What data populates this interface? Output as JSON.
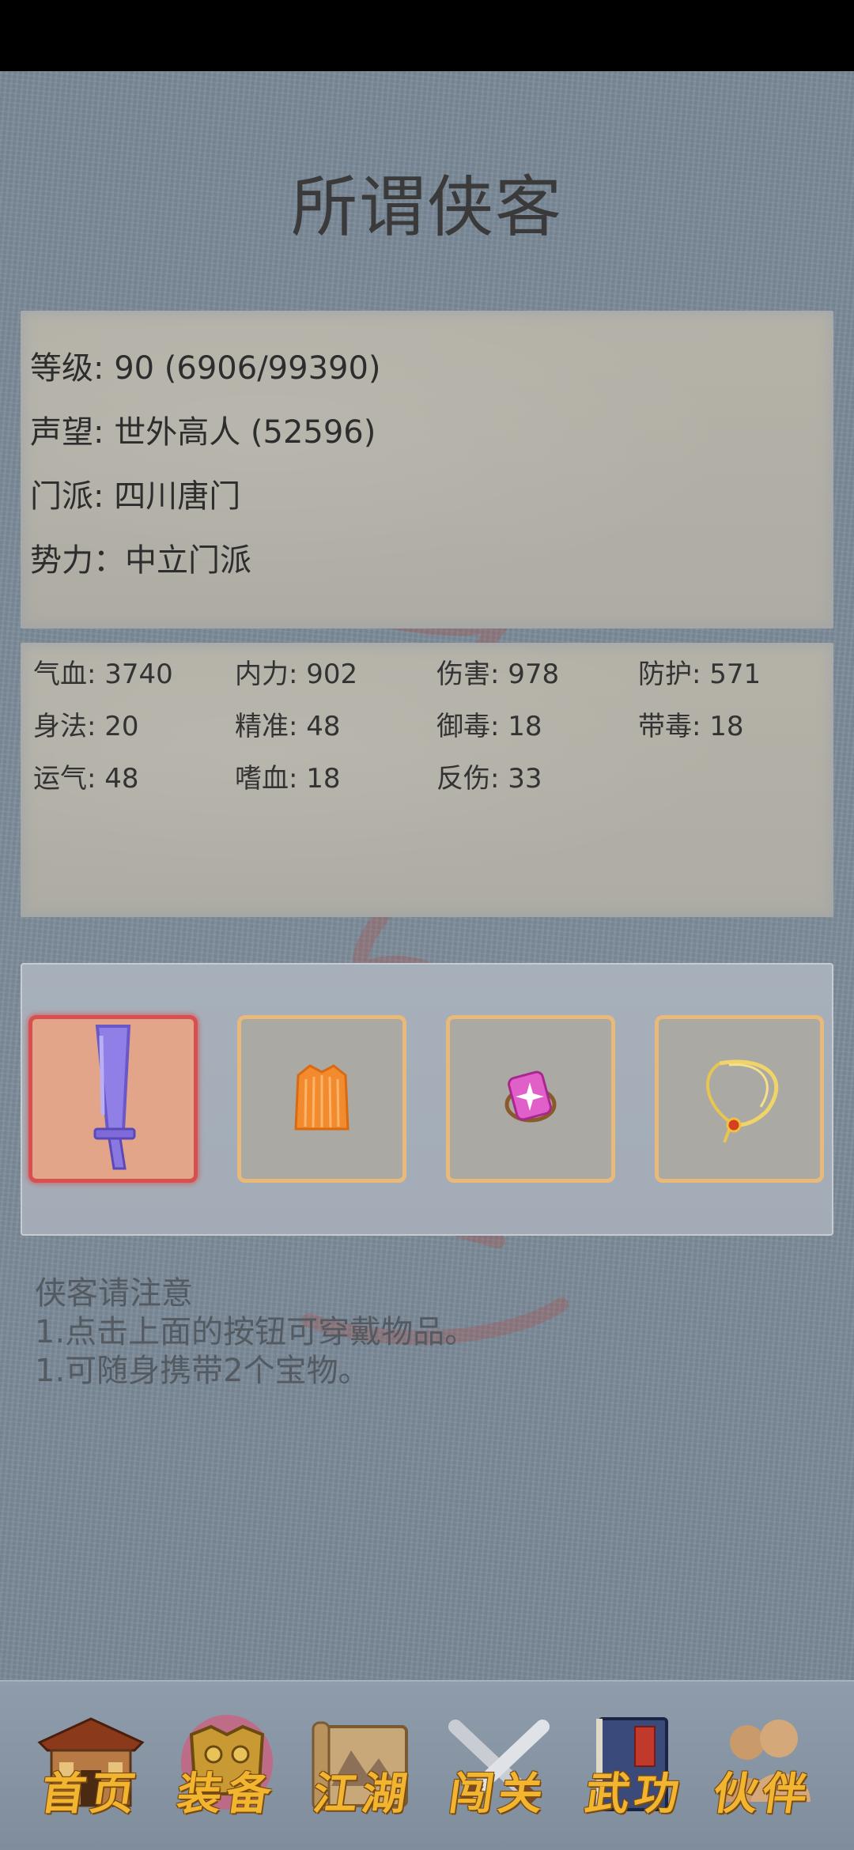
{
  "app": {
    "title": "所谓侠客"
  },
  "info": {
    "level": "等级: 90 (6906/99390)",
    "reputation": "声望: 世外高人 (52596)",
    "sect": "门派: 四川唐门",
    "faction": "势力：中立门派"
  },
  "stats": [
    {
      "label": "气血: 3740"
    },
    {
      "label": "内力: 902"
    },
    {
      "label": "伤害: 978"
    },
    {
      "label": "防护: 571"
    },
    {
      "label": "身法: 20"
    },
    {
      "label": "精准: 48"
    },
    {
      "label": "御毒: 18"
    },
    {
      "label": "带毒: 18"
    },
    {
      "label": "运气: 48"
    },
    {
      "label": "嗜血: 18"
    },
    {
      "label": "反伤: 33"
    }
  ],
  "equipment": {
    "slots": [
      {
        "icon": "sword-icon",
        "selected": true
      },
      {
        "icon": "robe-icon",
        "selected": false
      },
      {
        "icon": "gem-ring-icon",
        "selected": false
      },
      {
        "icon": "necklace-icon",
        "selected": false
      }
    ]
  },
  "notice": {
    "heading": "侠客请注意",
    "line1": "1.点击上面的按钮可穿戴物品。",
    "line2": "1.可随身携带2个宝物。"
  },
  "nav": {
    "items": [
      {
        "label": "首页",
        "icon": "house-icon"
      },
      {
        "label": "装备",
        "icon": "armor-icon"
      },
      {
        "label": "江湖",
        "icon": "scroll-map-icon"
      },
      {
        "label": "闯关",
        "icon": "crossed-swords-icon"
      },
      {
        "label": "武功",
        "icon": "book-icon"
      },
      {
        "label": "伙伴",
        "icon": "companions-icon"
      }
    ]
  },
  "colors": {
    "accent": "#f2b530",
    "selected_slot_border": "#d84f4f",
    "slot_border": "#e9b97a"
  }
}
